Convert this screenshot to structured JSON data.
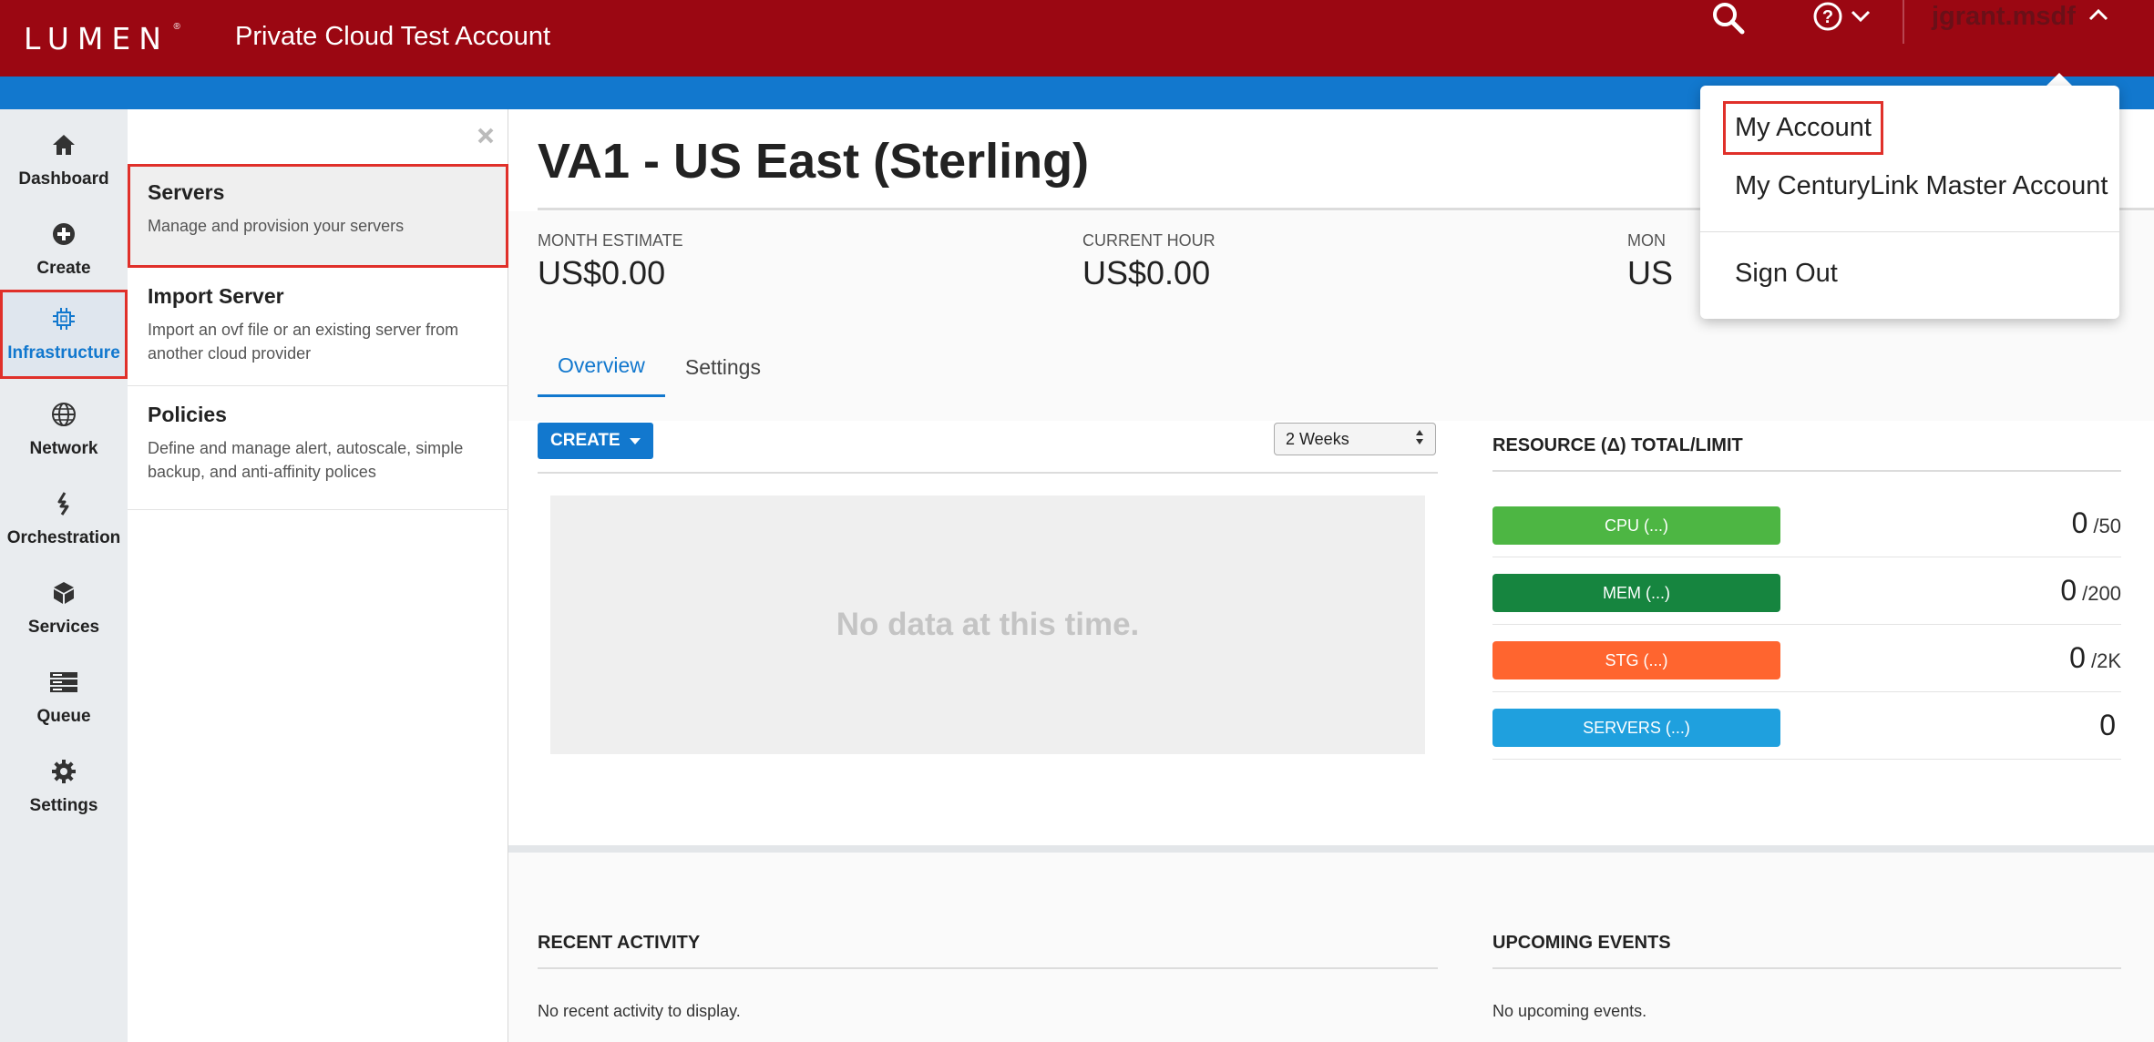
{
  "header": {
    "logo_text": "LUMEN",
    "logo_mark": "®",
    "account_title": "Private Cloud Test Account",
    "username": "jgrant.msdf",
    "icons": [
      "search-icon",
      "help-icon",
      "chevron-down-icon",
      "chevron-up-icon"
    ],
    "colors": {
      "bar": "#9b0712",
      "accent_bar": "#1278ce"
    }
  },
  "leftnav": {
    "items": [
      {
        "label": "Dashboard",
        "icon": "home-icon"
      },
      {
        "label": "Create",
        "icon": "plus-circle-icon"
      },
      {
        "label": "Infrastructure",
        "icon": "chip-icon",
        "active": true
      },
      {
        "label": "Network",
        "icon": "globe-icon"
      },
      {
        "label": "Orchestration",
        "icon": "orchestration-icon"
      },
      {
        "label": "Services",
        "icon": "cube-icon"
      },
      {
        "label": "Queue",
        "icon": "queue-icon"
      },
      {
        "label": "Settings",
        "icon": "gear-icon"
      }
    ]
  },
  "submenu": {
    "items": [
      {
        "title": "Servers",
        "desc": "Manage and provision your servers",
        "selected": true
      },
      {
        "title": "Import Server",
        "desc": "Import an ovf file or an existing server from another cloud provider"
      },
      {
        "title": "Policies",
        "desc": "Define and manage alert, autoscale, simple backup, and anti-affinity polices"
      }
    ]
  },
  "main": {
    "title": "VA1 - US East (Sterling)",
    "metrics": [
      {
        "label": "MONTH ESTIMATE",
        "value": "US$0.00"
      },
      {
        "label": "CURRENT HOUR",
        "value": "US$0.00"
      },
      {
        "label": "MON",
        "value": "US"
      }
    ],
    "tabs": [
      "Overview",
      "Settings"
    ],
    "create_label": "CREATE",
    "period": "2 Weeks",
    "no_data": "No data at this time.",
    "resource_title": "RESOURCE (Δ) TOTAL/LIMIT",
    "resources": [
      {
        "label": "CPU (...)",
        "value": "0",
        "limit": "/50",
        "color": "#4db643"
      },
      {
        "label": "MEM (...)",
        "value": "0",
        "limit": "/200",
        "color": "#16853f"
      },
      {
        "label": "STG (...)",
        "value": "0",
        "limit": "/2K",
        "color": "#ff652f"
      },
      {
        "label": "SERVERS (...)",
        "value": "0",
        "limit": "",
        "color": "#1fa0de"
      }
    ],
    "recent_title": "RECENT ACTIVITY",
    "recent_text": "No recent activity to display.",
    "upcoming_title": "UPCOMING EVENTS",
    "upcoming_text": "No upcoming events."
  },
  "account_menu": {
    "items": [
      "My Account",
      "My CenturyLink Master Account",
      "Sign Out"
    ],
    "highlighted": "My Account"
  }
}
